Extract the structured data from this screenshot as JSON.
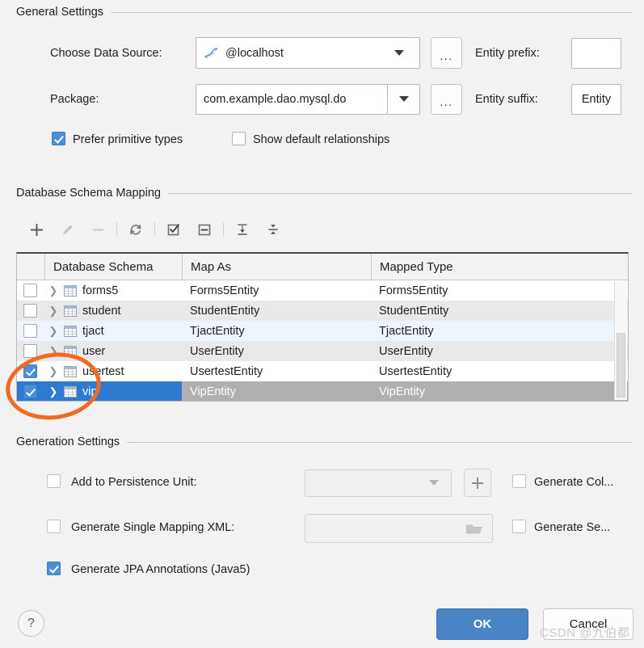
{
  "dialog": {
    "groups": {
      "general": "General Settings",
      "schema_mapping": "Database Schema Mapping",
      "generation": "Generation Settings"
    }
  },
  "general": {
    "data_source_label": "Choose Data Source:",
    "data_source_value": "@localhost",
    "data_source_icon": "mysql-dolphin-icon",
    "data_source_browse": "...",
    "package_label": "Package:",
    "package_value": "com.example.dao.mysql.do",
    "package_browse": "...",
    "entity_prefix_label": "Entity prefix:",
    "entity_prefix_value": "",
    "entity_suffix_label": "Entity suffix:",
    "entity_suffix_value": "Entity",
    "prefer_primitive_label": "Prefer primitive types",
    "prefer_primitive_checked": true,
    "show_default_rel_label": "Show default relationships",
    "show_default_rel_checked": false
  },
  "toolbar": {
    "items": [
      {
        "name": "add-button",
        "icon": "plus-icon",
        "enabled": true
      },
      {
        "name": "edit-button",
        "icon": "pencil-icon",
        "enabled": false
      },
      {
        "name": "remove-button",
        "icon": "minus-icon",
        "enabled": false
      },
      {
        "name": "refresh-button",
        "icon": "refresh-icon",
        "enabled": true
      },
      {
        "name": "select-all-button",
        "icon": "checked-box-icon",
        "enabled": true
      },
      {
        "name": "deselect-all-button",
        "icon": "unchecked-box-icon",
        "enabled": true
      },
      {
        "name": "expand-all-button",
        "icon": "expand-all-icon",
        "enabled": true
      },
      {
        "name": "collapse-all-button",
        "icon": "collapse-all-icon",
        "enabled": true
      }
    ]
  },
  "table": {
    "columns": [
      "",
      "Database Schema",
      "Map As",
      "Mapped Type"
    ],
    "rows": [
      {
        "checked": false,
        "name": "forms5",
        "map_as": "Forms5Entity",
        "mapped_type": "Forms5Entity",
        "stripe": "row-w",
        "selected": false
      },
      {
        "checked": false,
        "name": "student",
        "map_as": "StudentEntity",
        "mapped_type": "StudentEntity",
        "stripe": "row-g",
        "selected": false
      },
      {
        "checked": false,
        "name": "tjact",
        "map_as": "TjactEntity",
        "mapped_type": "TjactEntity",
        "stripe": "row-b",
        "selected": false
      },
      {
        "checked": false,
        "name": "user",
        "map_as": "UserEntity",
        "mapped_type": "UserEntity",
        "stripe": "row-g",
        "selected": false
      },
      {
        "checked": true,
        "name": "usertest",
        "map_as": "UsertestEntity",
        "mapped_type": "UsertestEntity",
        "stripe": "row-w",
        "selected": false
      },
      {
        "checked": true,
        "name": "vip",
        "map_as": "VipEntity",
        "mapped_type": "VipEntity",
        "stripe": "row-w",
        "selected": true
      }
    ]
  },
  "generation": {
    "persistence_unit_label": "Add to Persistence Unit:",
    "persistence_unit_checked": false,
    "persistence_unit_value": "",
    "persistence_add_button": "+",
    "single_mapping_label": "Generate Single Mapping XML:",
    "single_mapping_checked": false,
    "single_mapping_value": "",
    "single_mapping_browse_icon": "folder-icon",
    "jpa_annotations_label": "Generate JPA Annotations (Java5)",
    "jpa_annotations_checked": true,
    "generate_columns_label": "Generate Col...",
    "generate_columns_checked": false,
    "generate_separate_label": "Generate Se...",
    "generate_separate_checked": false
  },
  "footer": {
    "help": "?",
    "ok": "OK",
    "cancel": "Cancel"
  },
  "watermark": "CSDN @九伯都",
  "colors": {
    "accent": "#4a90d9",
    "selection": "#2f7ad0",
    "selection_muted": "#b0b0b0",
    "ok_button": "#4a84c4",
    "annotation": "#f26a21",
    "background": "#f2f2f2"
  }
}
